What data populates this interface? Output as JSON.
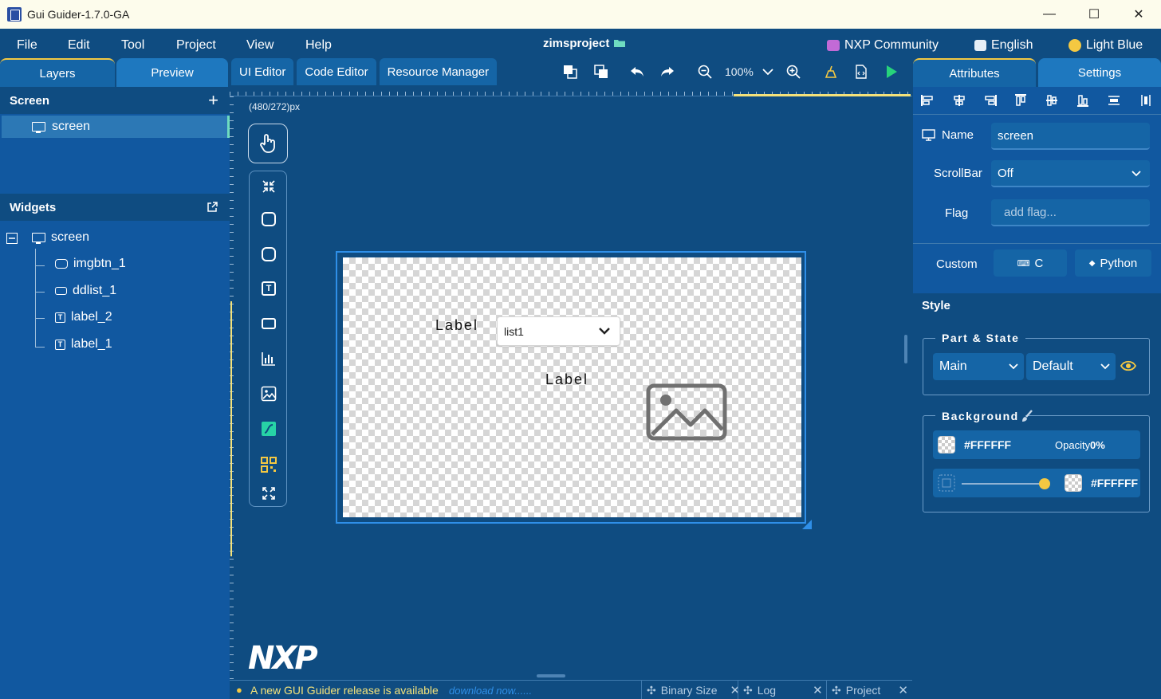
{
  "window": {
    "title": "Gui Guider-1.7.0-GA",
    "minimize": "—",
    "maximize": "☐",
    "close": "✕"
  },
  "menu": {
    "file": "File",
    "edit": "Edit",
    "tool": "Tool",
    "project": "Project",
    "view": "View",
    "help": "Help",
    "project_name": "zimsproject",
    "community": "NXP Community",
    "language": "English",
    "theme": "Light Blue"
  },
  "left_tabs": {
    "layers": "Layers",
    "preview": "Preview"
  },
  "editor_tabs": {
    "ui_editor": "UI Editor",
    "code_editor": "Code Editor",
    "resource_manager": "Resource Manager"
  },
  "toolbar": {
    "zoom": "100%"
  },
  "right_tabs": {
    "attributes": "Attributes",
    "settings": "Settings"
  },
  "screen_section": {
    "title": "Screen",
    "add": "+",
    "item": "screen"
  },
  "widgets_section": {
    "title": "Widgets",
    "root": "screen",
    "children": [
      "imgbtn_1",
      "ddlist_1",
      "label_2",
      "label_1"
    ]
  },
  "canvas": {
    "dimensions": "(480/272)px",
    "label_a": "Label",
    "label_b": "Label",
    "ddlist_value": "list1"
  },
  "logo": "NXP",
  "statusbar": {
    "message": "A new GUI Guider release is available",
    "link": "download now......",
    "tabs": [
      "Binary Size",
      "Log",
      "Project"
    ]
  },
  "attributes": {
    "name_label": "Name",
    "name_value": "screen",
    "scrollbar_label": "ScrollBar",
    "scrollbar_value": "Off",
    "flag_label": "Flag",
    "flag_placeholder": "add flag...",
    "custom_label": "Custom",
    "custom_c": "C",
    "custom_python": "Python"
  },
  "style": {
    "title": "Style",
    "part_state_title": "Part & State",
    "part": "Main",
    "state": "Default",
    "background_title": "Background",
    "bg_color": "#FFFFFF",
    "opacity_label": "Opacity",
    "opacity_value": "0%",
    "gradient_color": "#FFFFFF",
    "slider_position": 1.0
  },
  "colors": {
    "accent_yellow": "#f4c842",
    "panel_bg": "#0f4c81",
    "frame_blue": "#2f8fe8",
    "run_green": "#27d37b"
  }
}
